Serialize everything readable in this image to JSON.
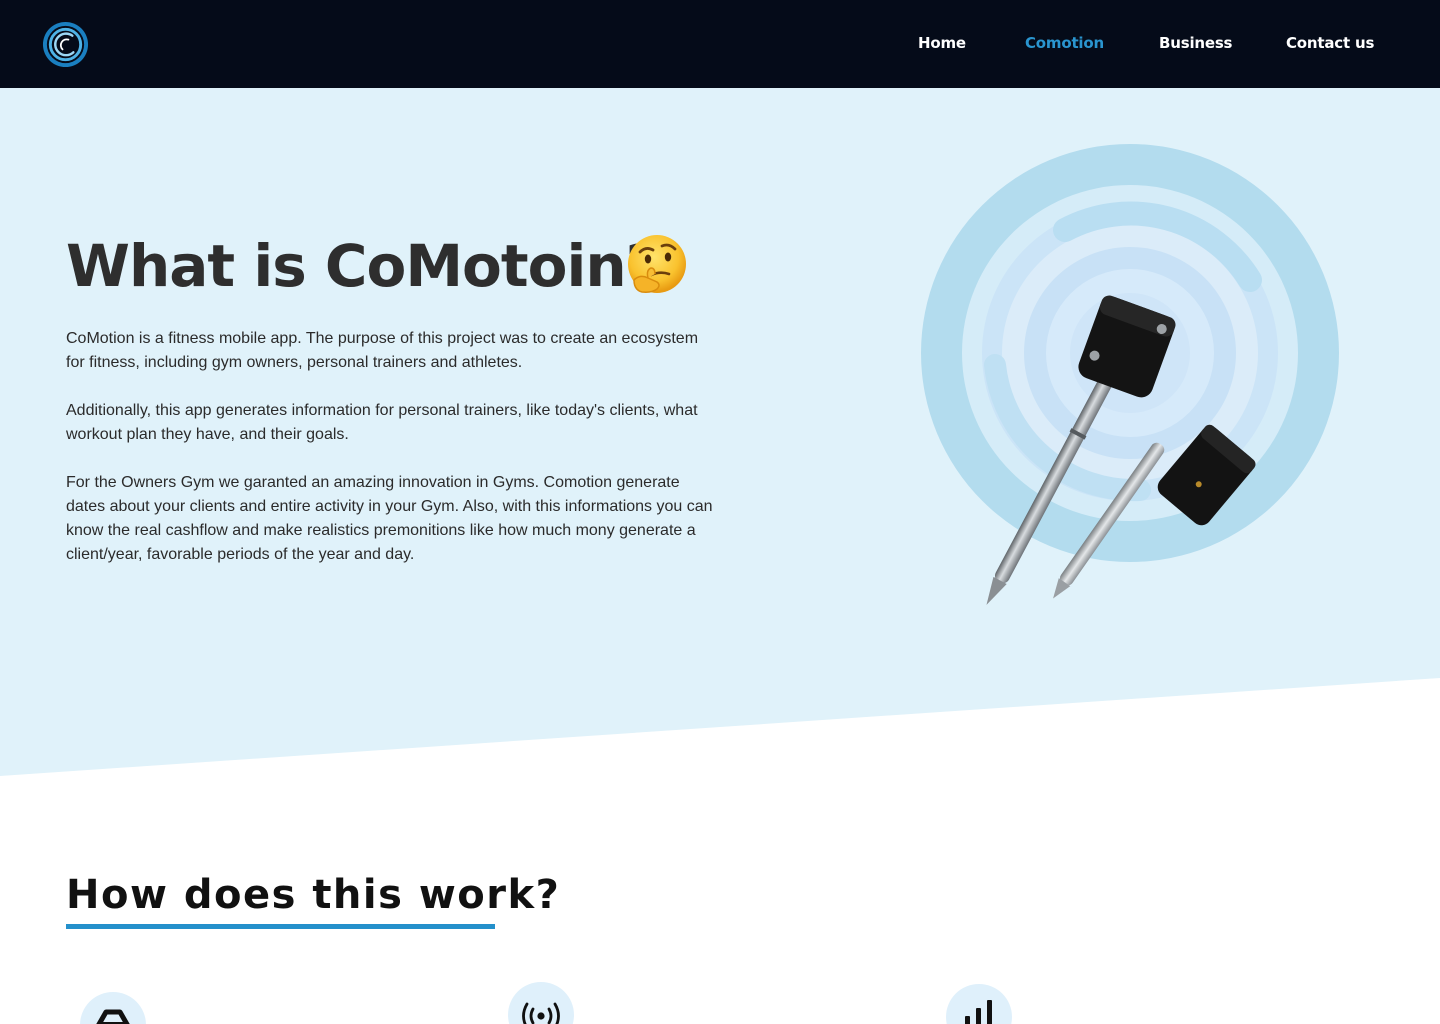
{
  "nav": {
    "logo_icon": "comotion-logo-icon",
    "items": [
      {
        "label": "Home",
        "active": false
      },
      {
        "label": "Comotion",
        "active": true
      },
      {
        "label": "Business",
        "active": false
      },
      {
        "label": "Contact us",
        "active": false
      }
    ]
  },
  "hero": {
    "title": "What is CoMotoin?",
    "title_emoji_icon": "thinking-face-icon",
    "paragraphs": [
      "CoMotion is a fitness mobile app. The purpose of this project was to create an ecosystem for fitness, including gym owners, personal trainers and athletes.",
      "Additionally, this app generates information for personal trainers, like today's clients, what workout plan they have, and their goals.",
      "For the Owners Gym we garanted an amazing innovation in Gyms. Comotion generate dates about your clients and entire activity in your Gym. Also, with this informations you can know the real cashflow and make realistics premonitions like how much mony generate a client/year, favorable periods of the year and day."
    ],
    "image_icon": "comotion-sensor-devices-image"
  },
  "how_it_works": {
    "title": "How does this work?",
    "step_icons": [
      "weight-plate-icon",
      "wireless-signal-icon",
      "bar-chart-icon"
    ]
  },
  "colors": {
    "nav_background": "#050b19",
    "accent": "#2a95cf",
    "hero_background": "#e0f2fa",
    "underline": "#2490cb"
  }
}
